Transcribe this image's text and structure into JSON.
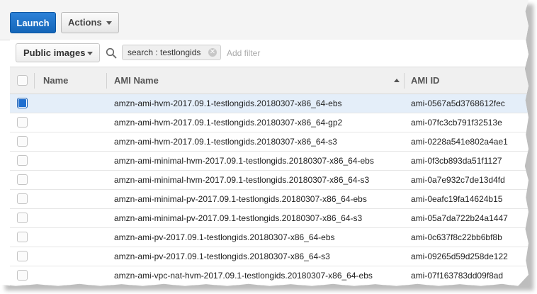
{
  "toolbar": {
    "launch_label": "Launch",
    "actions_label": "Actions"
  },
  "filter": {
    "scope_label": "Public images",
    "token_label": "search : testlongids",
    "add_filter_placeholder": "Add filter"
  },
  "table": {
    "columns": [
      "Name",
      "AMI Name",
      "AMI ID"
    ],
    "sort": {
      "column": "AMI Name",
      "direction": "ascending"
    },
    "rows": [
      {
        "name": "",
        "ami_name": "amzn-ami-hvm-2017.09.1-testlongids.20180307-x86_64-ebs",
        "ami_id": "ami-0567a5d3768612fec",
        "selected": true
      },
      {
        "name": "",
        "ami_name": "amzn-ami-hvm-2017.09.1-testlongids.20180307-x86_64-gp2",
        "ami_id": "ami-07fc3cb791f32513e",
        "selected": false
      },
      {
        "name": "",
        "ami_name": "amzn-ami-hvm-2017.09.1-testlongids.20180307-x86_64-s3",
        "ami_id": "ami-0228a541e802a4ae1",
        "selected": false
      },
      {
        "name": "",
        "ami_name": "amzn-ami-minimal-hvm-2017.09.1-testlongids.20180307-x86_64-ebs",
        "ami_id": "ami-0f3cb893da51f1127",
        "selected": false
      },
      {
        "name": "",
        "ami_name": "amzn-ami-minimal-hvm-2017.09.1-testlongids.20180307-x86_64-s3",
        "ami_id": "ami-0a7e932c7de13d4fd",
        "selected": false
      },
      {
        "name": "",
        "ami_name": "amzn-ami-minimal-pv-2017.09.1-testlongids.20180307-x86_64-ebs",
        "ami_id": "ami-0eafc19fa14624b15",
        "selected": false
      },
      {
        "name": "",
        "ami_name": "amzn-ami-minimal-pv-2017.09.1-testlongids.20180307-x86_64-s3",
        "ami_id": "ami-05a7da722b24a1447",
        "selected": false
      },
      {
        "name": "",
        "ami_name": "amzn-ami-pv-2017.09.1-testlongids.20180307-x86_64-ebs",
        "ami_id": "ami-0c637f8c22bb6bf8b",
        "selected": false
      },
      {
        "name": "",
        "ami_name": "amzn-ami-pv-2017.09.1-testlongids.20180307-x86_64-s3",
        "ami_id": "ami-09265d59d258de122",
        "selected": false
      },
      {
        "name": "",
        "ami_name": "amzn-ami-vpc-nat-hvm-2017.09.1-testlongids.20180307-x86_64-ebs",
        "ami_id": "ami-07f163783dd09f8ad",
        "selected": false
      }
    ]
  },
  "colors": {
    "primary_button": "#1466b8",
    "selected_row": "#e4eef9",
    "checkbox_checked": "#1f6fd0"
  },
  "icons": [
    "caret-down-icon",
    "search-icon",
    "clear-icon",
    "sort-ascending-icon"
  ]
}
